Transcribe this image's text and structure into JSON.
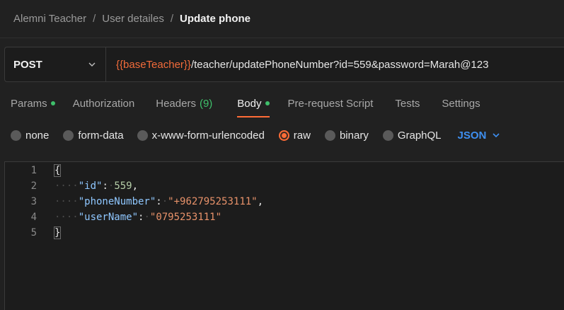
{
  "breadcrumb": {
    "items": [
      "Alemni Teacher",
      "User detailes"
    ],
    "separator": "/",
    "current": "Update phone"
  },
  "request": {
    "method": "POST",
    "url_variable": "{{baseTeacher}}",
    "url_path": "/teacher/updatePhoneNumber?id=559&password=Marah@123"
  },
  "tabs": {
    "params": "Params",
    "authorization": "Authorization",
    "headers": "Headers",
    "headers_count": "(9)",
    "body": "Body",
    "prerequest": "Pre-request Script",
    "tests": "Tests",
    "settings": "Settings",
    "active": "Body"
  },
  "body_types": {
    "none": "none",
    "form_data": "form-data",
    "urlencoded": "x-www-form-urlencoded",
    "raw": "raw",
    "binary": "binary",
    "graphql": "GraphQL",
    "selected": "raw",
    "format": "JSON"
  },
  "editor": {
    "line_numbers": [
      "1",
      "2",
      "3",
      "4",
      "5"
    ],
    "open_brace": "{",
    "close_brace": "}",
    "fields": [
      {
        "key": "\"id\"",
        "value": "559",
        "trailing": ","
      },
      {
        "key": "\"phoneNumber\"",
        "value": "\"+962795253111\"",
        "trailing": ","
      },
      {
        "key": "\"userName\"",
        "value": "\"0795253111\"",
        "trailing": ""
      }
    ]
  },
  "colors": {
    "accent": "#ff6c37",
    "status_green": "#3fc06b",
    "link_blue": "#3e8ff0",
    "json_key": "#8fc7ff",
    "json_string": "#e8926a"
  }
}
